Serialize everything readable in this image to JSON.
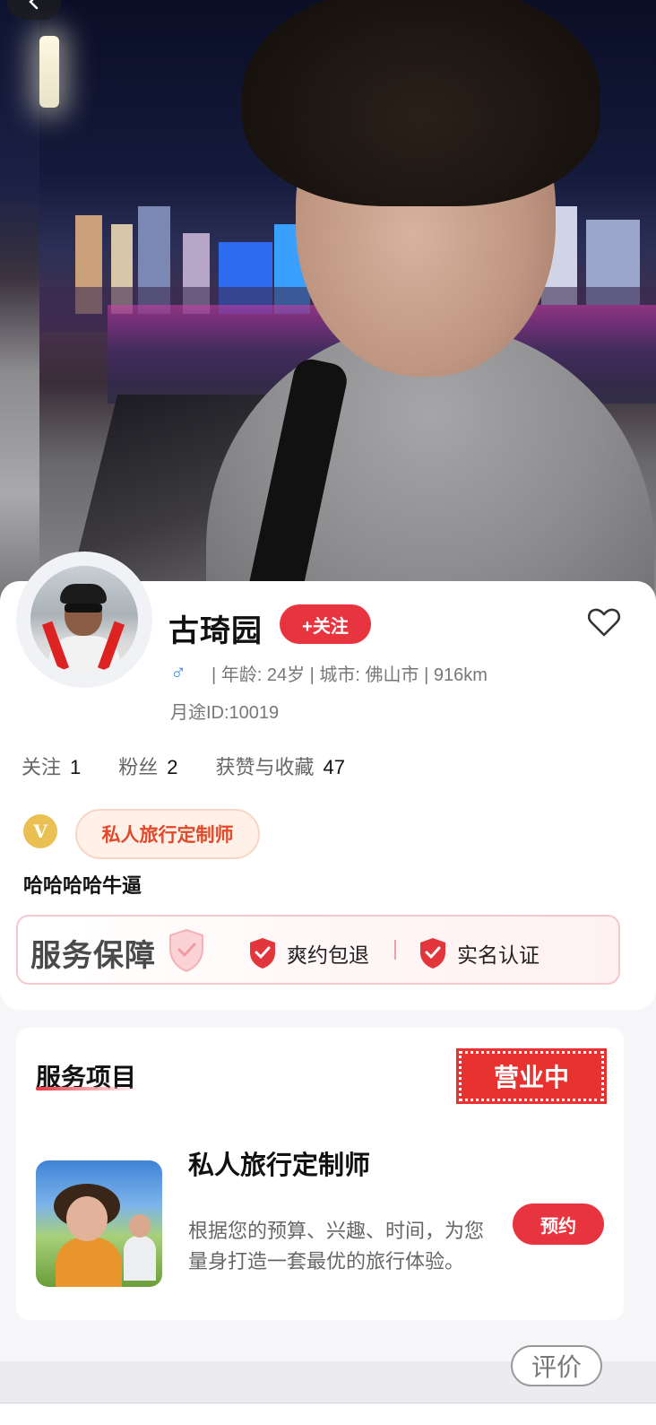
{
  "profile": {
    "name": "古琦园",
    "follow_label": "+关注",
    "info": "| 年龄: 24岁 | 城市: 佛山市 | 916km",
    "gender_symbol": "♂",
    "id_text": "月途ID:10019",
    "stats": [
      {
        "label": "关注",
        "value": "1"
      },
      {
        "label": "粉丝",
        "value": "2"
      },
      {
        "label": "获赞与收藏",
        "value": "47"
      }
    ],
    "vip_badge": "V",
    "tag": "私人旅行定制师",
    "bio": "哈哈哈哈牛逼"
  },
  "guarantee": {
    "title": "服务保障",
    "items": [
      "爽约包退",
      "实名认证"
    ],
    "separator": "|"
  },
  "service": {
    "section_title": "服务项目",
    "status_stamp": "营业中",
    "item_name": "私人旅行定制师",
    "item_desc": "根据您的预算、兴趣、时间，为您量身打造一套最优的旅行体验。",
    "book_label": "预约"
  },
  "footer": {
    "review_label": "评价"
  },
  "icons": {
    "back": "back-arrow-icon",
    "favorite": "heart-outline-icon",
    "check_shield": "check-shield-icon"
  },
  "colors": {
    "accent": "#e8343f",
    "tag_text": "#e04a2a",
    "vip": "#eac052",
    "male": "#3a8fe8"
  }
}
